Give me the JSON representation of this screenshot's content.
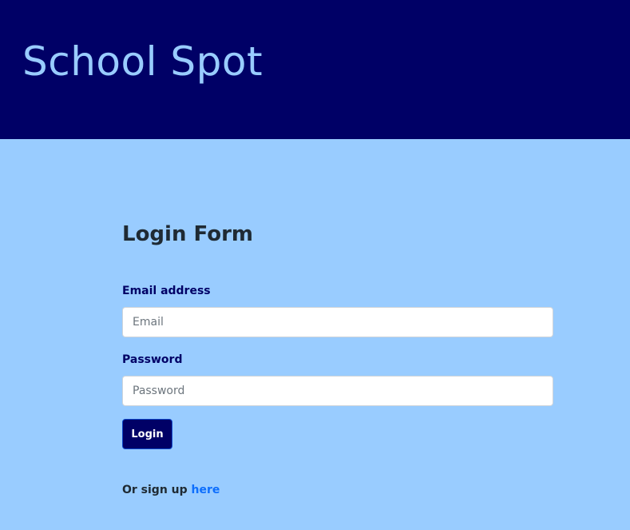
{
  "header": {
    "brand": "School Spot"
  },
  "login_form": {
    "title": "Login Form",
    "email": {
      "label": "Email address",
      "placeholder": "Email",
      "value": ""
    },
    "password": {
      "label": "Password",
      "placeholder": "Password",
      "value": ""
    },
    "submit_label": "Login",
    "signup_prompt": "Or sign up ",
    "signup_link": "here"
  },
  "colors": {
    "header_bg": "#000066",
    "brand_text": "#99ccff",
    "page_bg": "#99ccff",
    "label_text": "#000066",
    "button_bg": "#000066",
    "link": "#0d6efd"
  }
}
